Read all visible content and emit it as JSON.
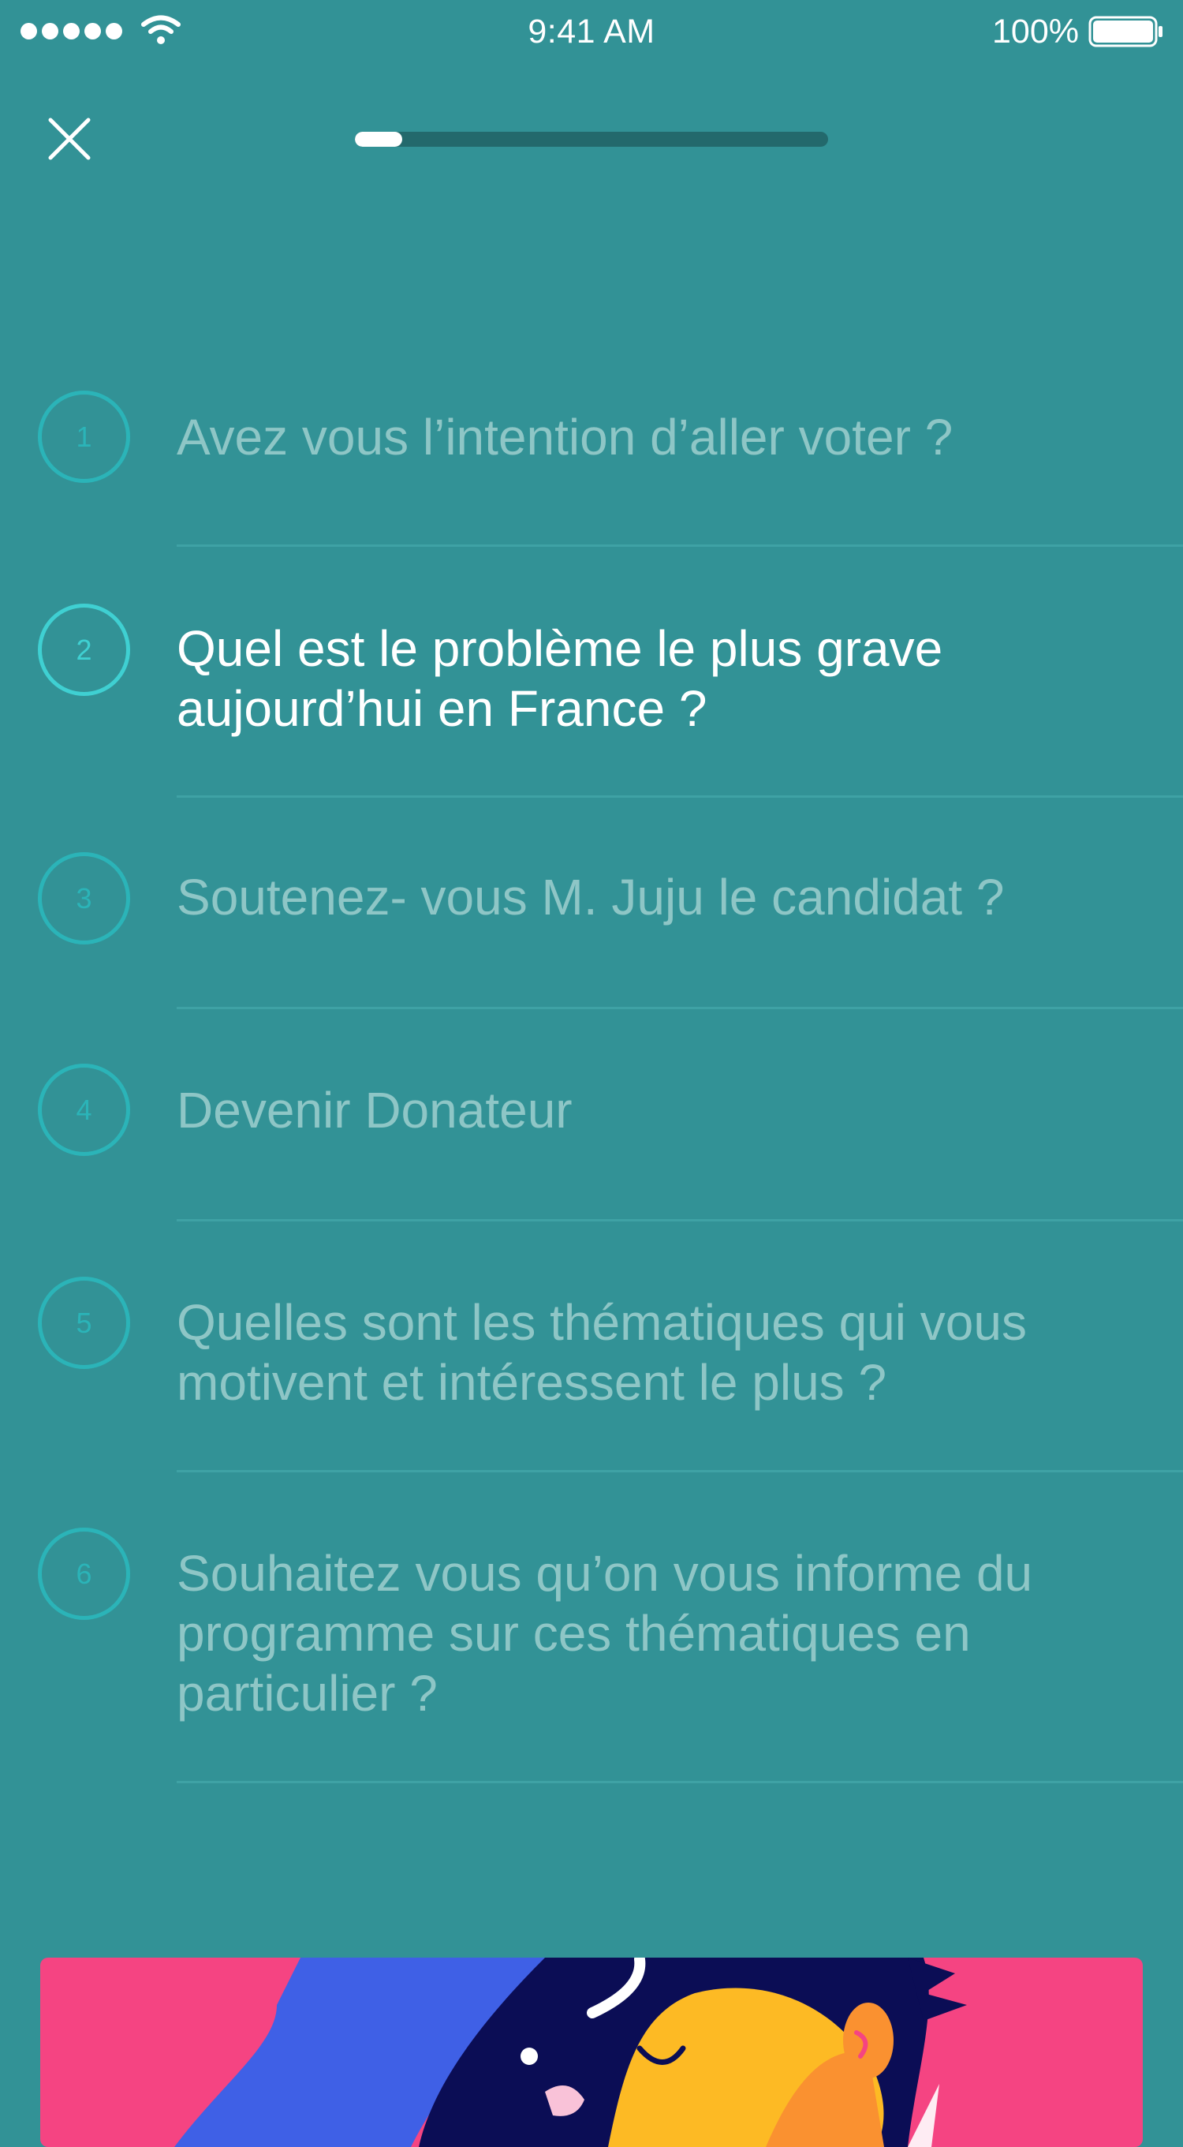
{
  "status_bar": {
    "time": "9:41 AM",
    "battery_percent": "100%",
    "signal_bars": 5,
    "icons": [
      "signal-dots-icon",
      "wifi-icon",
      "battery-icon"
    ]
  },
  "nav": {
    "close_icon": "close-icon",
    "progress": 0.1
  },
  "questions": [
    {
      "number": "1",
      "text": "Avez vous l’intention d’aller voter ?",
      "active": false
    },
    {
      "number": "2",
      "text": "Quel est le problème le plus grave aujourd’hui  en France ?",
      "active": true
    },
    {
      "number": "3",
      "text": "Soutenez- vous M. Juju le candidat  ?",
      "active": false
    },
    {
      "number": "4",
      "text": "Devenir Donateur",
      "active": false
    },
    {
      "number": "5",
      "text": "Quelles sont les thématiques qui vous motivent et intéressent le plus ?",
      "active": false
    },
    {
      "number": "6",
      "text": "Souhaitez vous qu’on vous informe du programme sur ces thématiques en particulier ?",
      "active": false
    }
  ],
  "colors": {
    "background": "#329296",
    "accent_circle": "#2bb4b8",
    "active_circle": "#3fd0d2",
    "inactive_text": "#8ec6c6",
    "active_text": "#ffffff",
    "card_background": "#f54482"
  },
  "card": {
    "illustration": "person-illustration"
  }
}
